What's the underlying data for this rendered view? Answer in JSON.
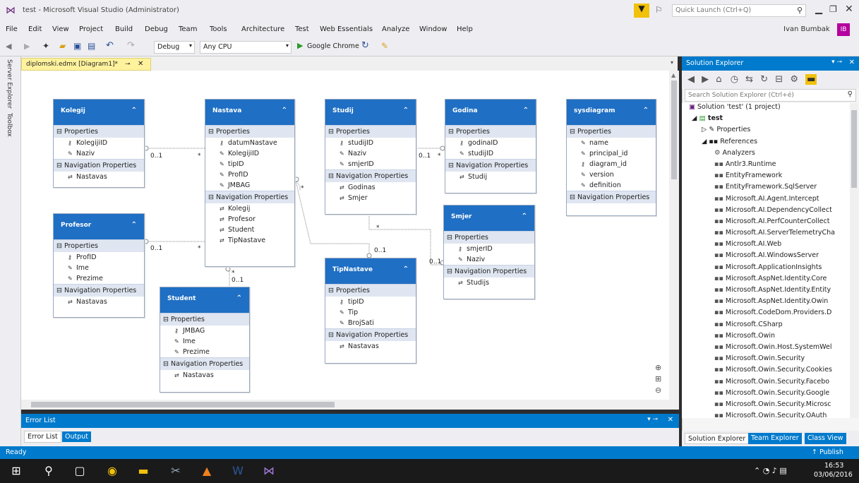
{
  "window": {
    "title": "test - Microsoft Visual Studio (Administrator)",
    "quick_launch_placeholder": "Quick Launch (Ctrl+Q)",
    "user": "Ivan Bumbak",
    "user_initials": "IB"
  },
  "menu": [
    "File",
    "Edit",
    "View",
    "Project",
    "Build",
    "Debug",
    "Team",
    "Tools",
    "Architecture",
    "Test",
    "Web Essentials",
    "Analyze",
    "Window",
    "Help"
  ],
  "toolbar": {
    "config": "Debug",
    "platform": "Any CPU",
    "run_target": "Google Chrome"
  },
  "left_strip": {
    "server_explorer": "Server Explorer",
    "toolbox": "Toolbox"
  },
  "document_tab": "diplomski.edmx [Diagram1]*",
  "entities": {
    "kolegij": {
      "name": "Kolegij",
      "properties_label": "Properties",
      "properties": [
        "KolegijiID",
        "Naziv"
      ],
      "nav_label": "Navigation Properties",
      "nav": [
        "Nastavas"
      ]
    },
    "profesor": {
      "name": "Profesor",
      "properties_label": "Properties",
      "properties": [
        "ProfID",
        "Ime",
        "Prezime"
      ],
      "nav_label": "Navigation Properties",
      "nav": [
        "Nastavas"
      ]
    },
    "nastava": {
      "name": "Nastava",
      "properties_label": "Properties",
      "properties": [
        "datumNastave",
        "KolegijiID",
        "tipID",
        "ProfID",
        "JMBAG"
      ],
      "nav_label": "Navigation Properties",
      "nav": [
        "Kolegij",
        "Profesor",
        "Student",
        "TipNastave"
      ]
    },
    "student": {
      "name": "Student",
      "properties_label": "Properties",
      "properties": [
        "JMBAG",
        "Ime",
        "Prezime"
      ],
      "nav_label": "Navigation Properties",
      "nav": [
        "Nastavas"
      ]
    },
    "studij": {
      "name": "Studij",
      "properties_label": "Properties",
      "properties": [
        "studijID",
        "Naziv",
        "smjerID"
      ],
      "nav_label": "Navigation Properties",
      "nav": [
        "Godinas",
        "Smjer"
      ]
    },
    "tipnastave": {
      "name": "TipNastave",
      "properties_label": "Properties",
      "properties": [
        "tipID",
        "Tip",
        "BrojSati"
      ],
      "nav_label": "Navigation Properties",
      "nav": [
        "Nastavas"
      ]
    },
    "godina": {
      "name": "Godina",
      "properties_label": "Properties",
      "properties": [
        "godinaID",
        "studijID"
      ],
      "nav_label": "Navigation Properties",
      "nav": [
        "Studij"
      ]
    },
    "smjer": {
      "name": "Smjer",
      "properties_label": "Properties",
      "properties": [
        "smjerID",
        "Naziv"
      ],
      "nav_label": "Navigation Properties",
      "nav": [
        "Studijs"
      ]
    },
    "sysdiagram": {
      "name": "sysdiagram",
      "properties_label": "Properties",
      "properties": [
        "name",
        "principal_id",
        "diagram_id",
        "version",
        "definition"
      ],
      "nav_label": "Navigation Properties",
      "nav": []
    }
  },
  "multiplicities": {
    "m1": "0..1",
    "m2": "*",
    "m3": "0..1",
    "m4": "*",
    "m5": "0..1",
    "m6": "*",
    "m7": "0..1",
    "m8": "*",
    "m9": "0..1",
    "m10": "*",
    "m11": "0..1",
    "m12": "*",
    "m13": "0..1"
  },
  "solution_explorer": {
    "title": "Solution Explorer",
    "search_placeholder": "Search Solution Explorer (Ctrl+é)",
    "solution": "Solution 'test' (1 project)",
    "project": "test",
    "properties": "Properties",
    "references": "References",
    "items": [
      "Analyzers",
      "Antlr3.Runtime",
      "EntityFramework",
      "EntityFramework.SqlServer",
      "Microsoft.AI.Agent.Intercept",
      "Microsoft.AI.DependencyCollect",
      "Microsoft.AI.PerfCounterCollect",
      "Microsoft.AI.ServerTelemetryCha",
      "Microsoft.AI.Web",
      "Microsoft.AI.WindowsServer",
      "Microsoft.ApplicationInsights",
      "Microsoft.AspNet.Identity.Core",
      "Microsoft.AspNet.Identity.Entity",
      "Microsoft.AspNet.Identity.Owin",
      "Microsoft.CodeDom.Providers.D",
      "Microsoft.CSharp",
      "Microsoft.Owin",
      "Microsoft.Owin.Host.SystemWel",
      "Microsoft.Owin.Security",
      "Microsoft.Owin.Security.Cookies",
      "Microsoft.Owin.Security.Facebo",
      "Microsoft.Owin.Security.Google",
      "Microsoft.Owin.Security.Microsc",
      "Microsoft.Owin.Security.OAuth"
    ],
    "tabs": [
      "Solution Explorer",
      "Team Explorer",
      "Class View"
    ]
  },
  "error_list": {
    "title": "Error List",
    "tabs": [
      "Error List",
      "Output"
    ]
  },
  "status": {
    "left": "Ready",
    "right": "↑ Publish"
  },
  "taskbar": {
    "time": "16:53",
    "date": "03/06/2016"
  },
  "colors": {
    "accent": "#007acc",
    "entity_header": "#1f6fc4"
  }
}
